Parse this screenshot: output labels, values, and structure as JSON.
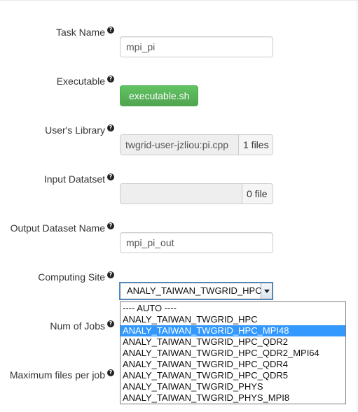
{
  "form": {
    "task_name": {
      "label": "Task Name",
      "value": "mpi_pi"
    },
    "executable": {
      "label": "Executable",
      "button": "executable.sh"
    },
    "users_library": {
      "label": "User's Library",
      "value": "twgrid-user-jzliou:pi.cpp",
      "count": "1 files"
    },
    "input_dataset": {
      "label": "Input Datatset",
      "value": "",
      "count": "0 file"
    },
    "output_dataset": {
      "label": "Output Dataset Name",
      "value": "mpi_pi_out"
    },
    "computing_site": {
      "label": "Computing Site",
      "selected": "ANALY_TAIWAN_TWGRID_HPC_MPI48",
      "options": [
        "---- AUTO ----",
        "ANALY_TAIWAN_TWGRID_HPC",
        "ANALY_TAIWAN_TWGRID_HPC_MPI48",
        "ANALY_TAIWAN_TWGRID_HPC_QDR2",
        "ANALY_TAIWAN_TWGRID_HPC_QDR2_MPI64",
        "ANALY_TAIWAN_TWGRID_HPC_QDR4",
        "ANALY_TAIWAN_TWGRID_HPC_QDR5",
        "ANALY_TAIWAN_TWGRID_PHYS",
        "ANALY_TAIWAN_TWGRID_PHYS_MPI8"
      ],
      "selected_index": 2
    },
    "num_of_jobs": {
      "label": "Num of Jobs"
    },
    "max_files_per_job": {
      "label": "Maximum files per job"
    }
  },
  "help_glyph": "?"
}
